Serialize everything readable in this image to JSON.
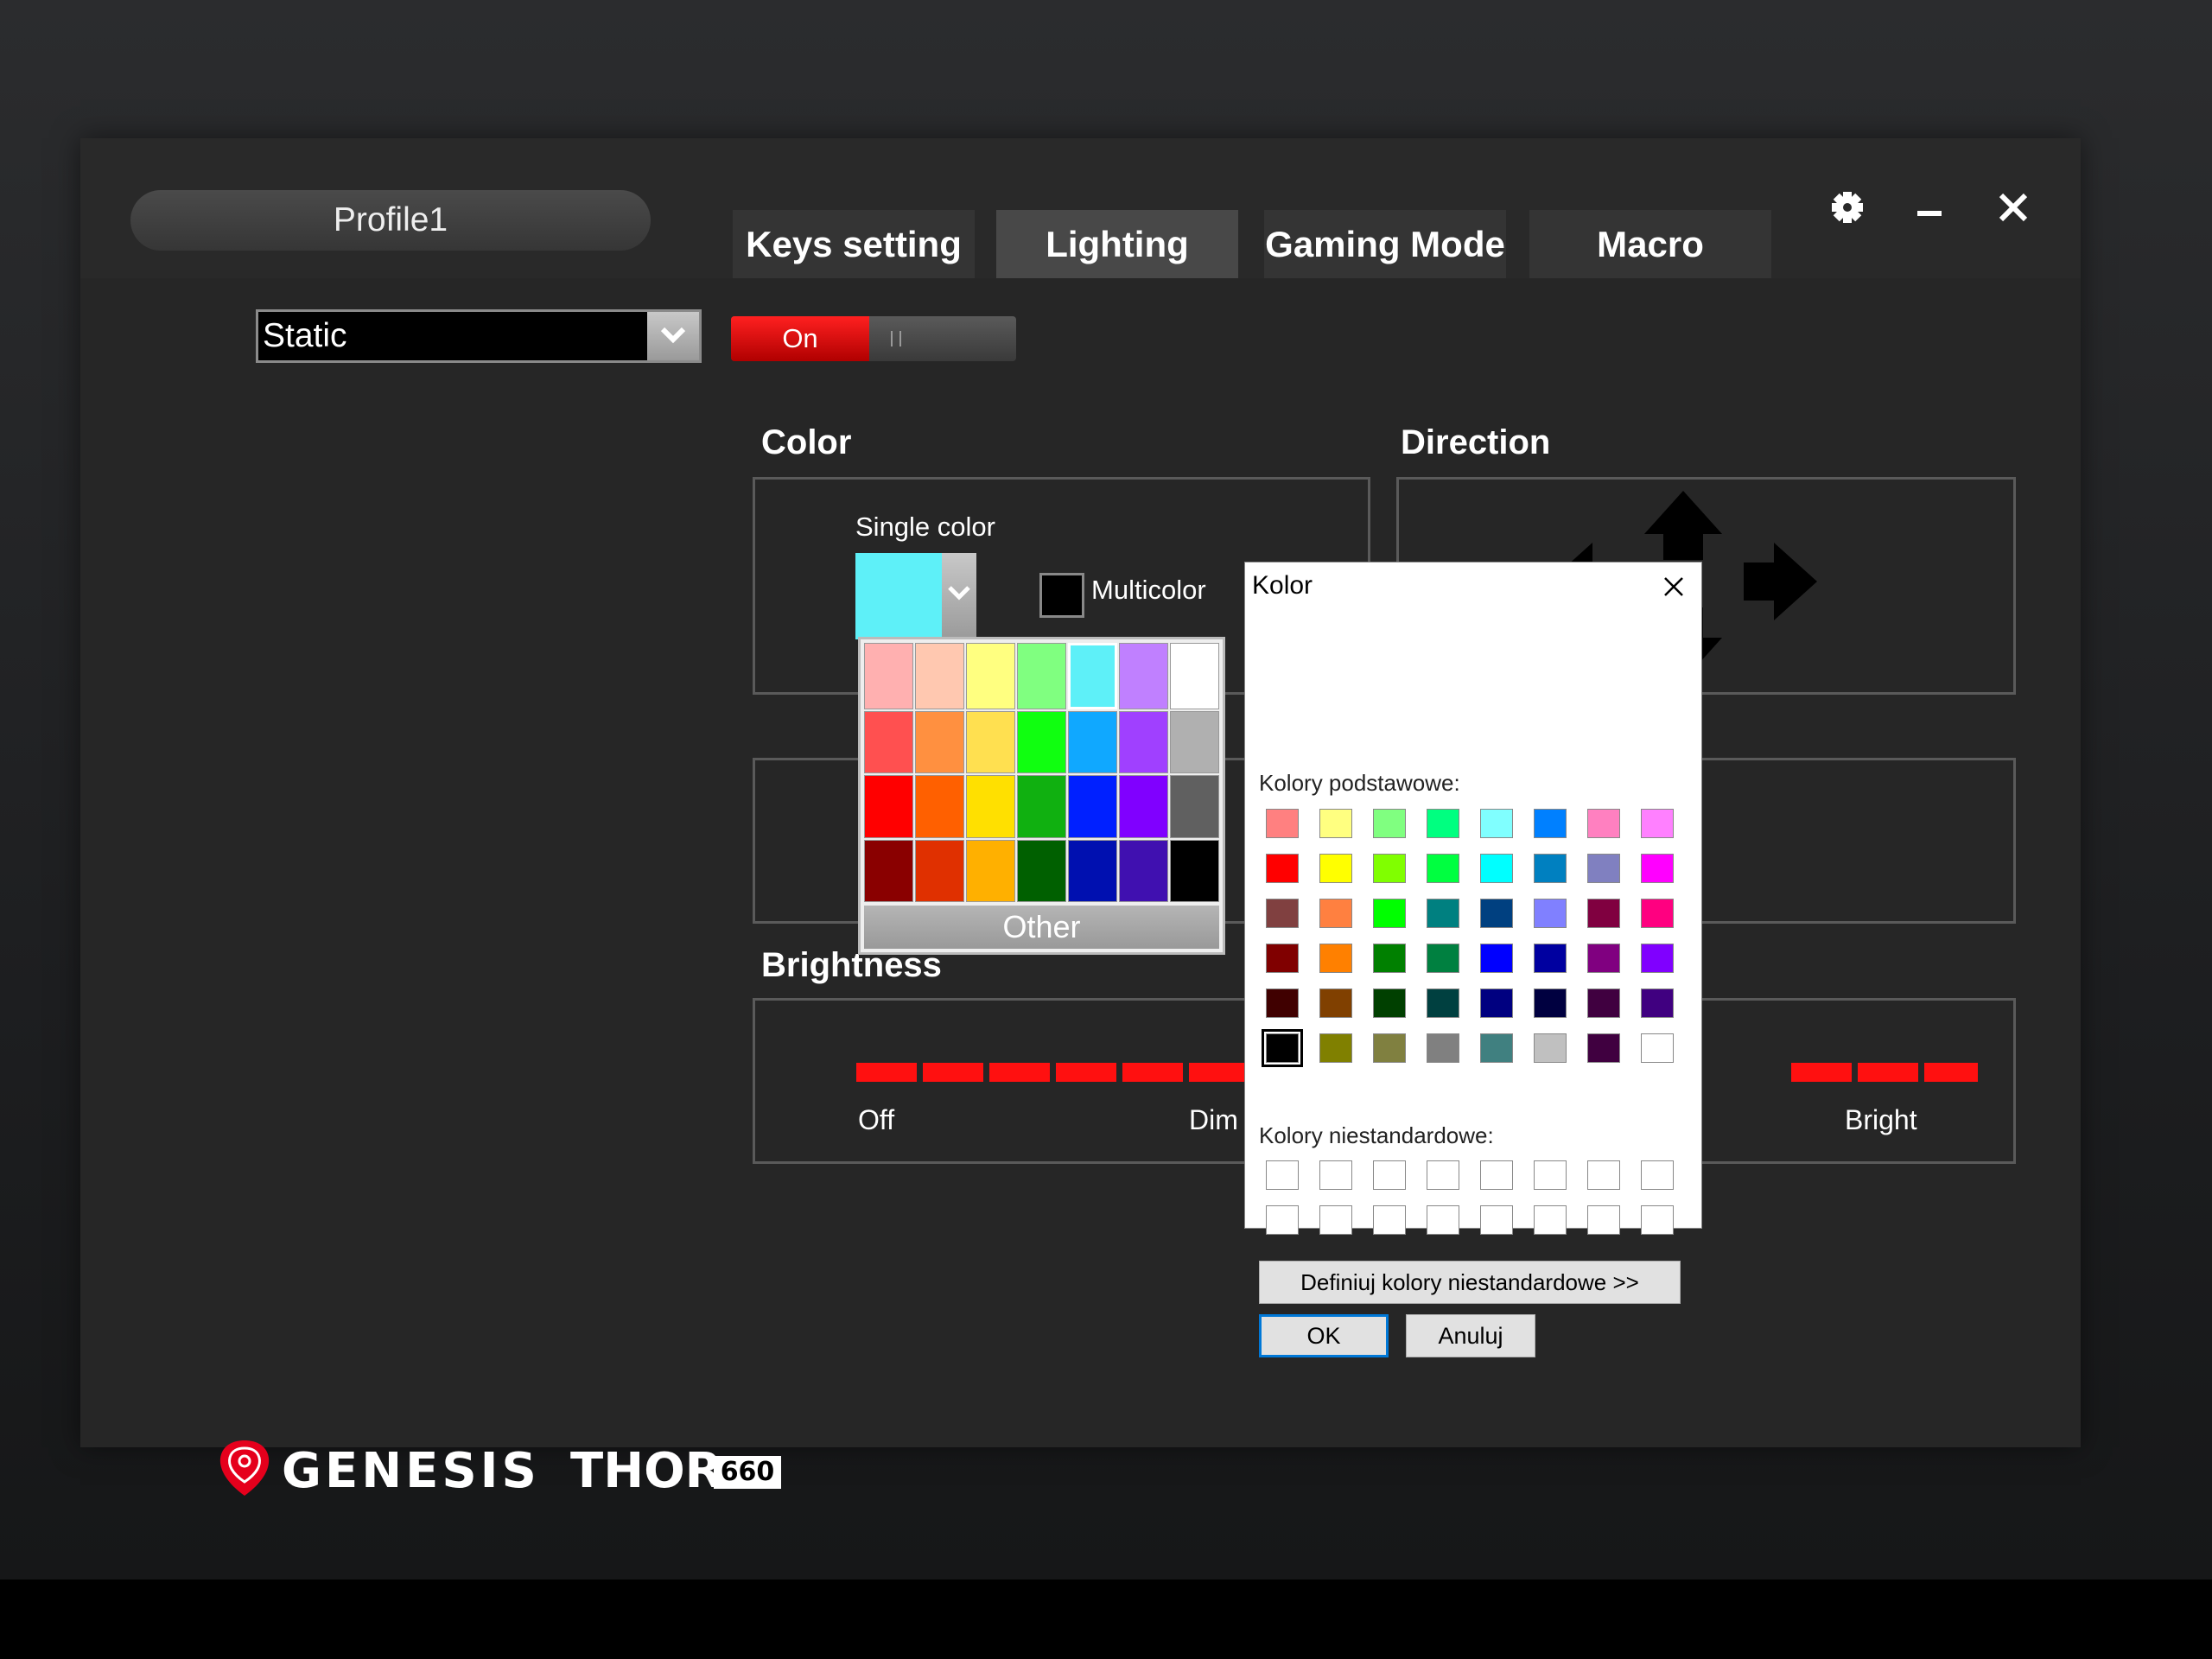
{
  "header": {
    "profile": "Profile1",
    "tabs": [
      {
        "label": "Keys setting"
      },
      {
        "label": "Lighting"
      },
      {
        "label": "Gaming Mode"
      },
      {
        "label": "Macro"
      }
    ],
    "active_tab": "Lighting",
    "icons": [
      "gear-icon",
      "minimize-icon",
      "close-icon"
    ]
  },
  "controls": {
    "mode": "Static",
    "toggle": "On"
  },
  "sections": {
    "color": "Color",
    "direction": "Direction",
    "brightness": "Brightness"
  },
  "color": {
    "single_label": "Single color",
    "multicolor_label": "Multicolor",
    "selected": "#5ef0f8",
    "palette": [
      "#ffb0b0",
      "#ffc8b0",
      "#ffff80",
      "#80ff80",
      "#5ef0f8",
      "#c080ff",
      "#ffffff",
      "#ff5050",
      "#ff9040",
      "#ffe050",
      "#10ff10",
      "#10a8ff",
      "#a040ff",
      "#b0b0b0",
      "#ff0000",
      "#ff6000",
      "#ffe000",
      "#10b010",
      "#0020ff",
      "#8000ff",
      "#606060",
      "#8a0000",
      "#e03000",
      "#ffb000",
      "#006000",
      "#0010b0",
      "#4010b0",
      "#000000"
    ],
    "other_label": "Other"
  },
  "brightness": {
    "level": 1.0,
    "labels": {
      "off": "Off",
      "dim": "Dim",
      "bright": "Bright"
    }
  },
  "dialog": {
    "title": "Kolor",
    "basic_label": "Kolory podstawowe:",
    "basic_colors": [
      "#ff8080",
      "#ffff80",
      "#80ff80",
      "#00ff80",
      "#80ffff",
      "#0080ff",
      "#ff80c0",
      "#ff80ff",
      "#ff0000",
      "#ffff00",
      "#80ff00",
      "#00ff40",
      "#00ffff",
      "#0080c0",
      "#8080c0",
      "#ff00ff",
      "#804040",
      "#ff8040",
      "#00ff00",
      "#008080",
      "#004080",
      "#8080ff",
      "#800040",
      "#ff0080",
      "#800000",
      "#ff8000",
      "#008000",
      "#008040",
      "#0000ff",
      "#0000a0",
      "#800080",
      "#8000ff",
      "#400000",
      "#804000",
      "#004000",
      "#004040",
      "#000080",
      "#000040",
      "#400040",
      "#400080",
      "#000000",
      "#808000",
      "#808040",
      "#808080",
      "#408080",
      "#c0c0c0",
      "#400040",
      "#ffffff"
    ],
    "custom_label": "Kolory niestandardowe:",
    "define_button": "Definiuj kolory niestandardowe >>",
    "ok_button": "OK",
    "cancel_button": "Anuluj"
  },
  "logo": {
    "brand": "GENESIS",
    "product": "THOR",
    "model": "660"
  }
}
